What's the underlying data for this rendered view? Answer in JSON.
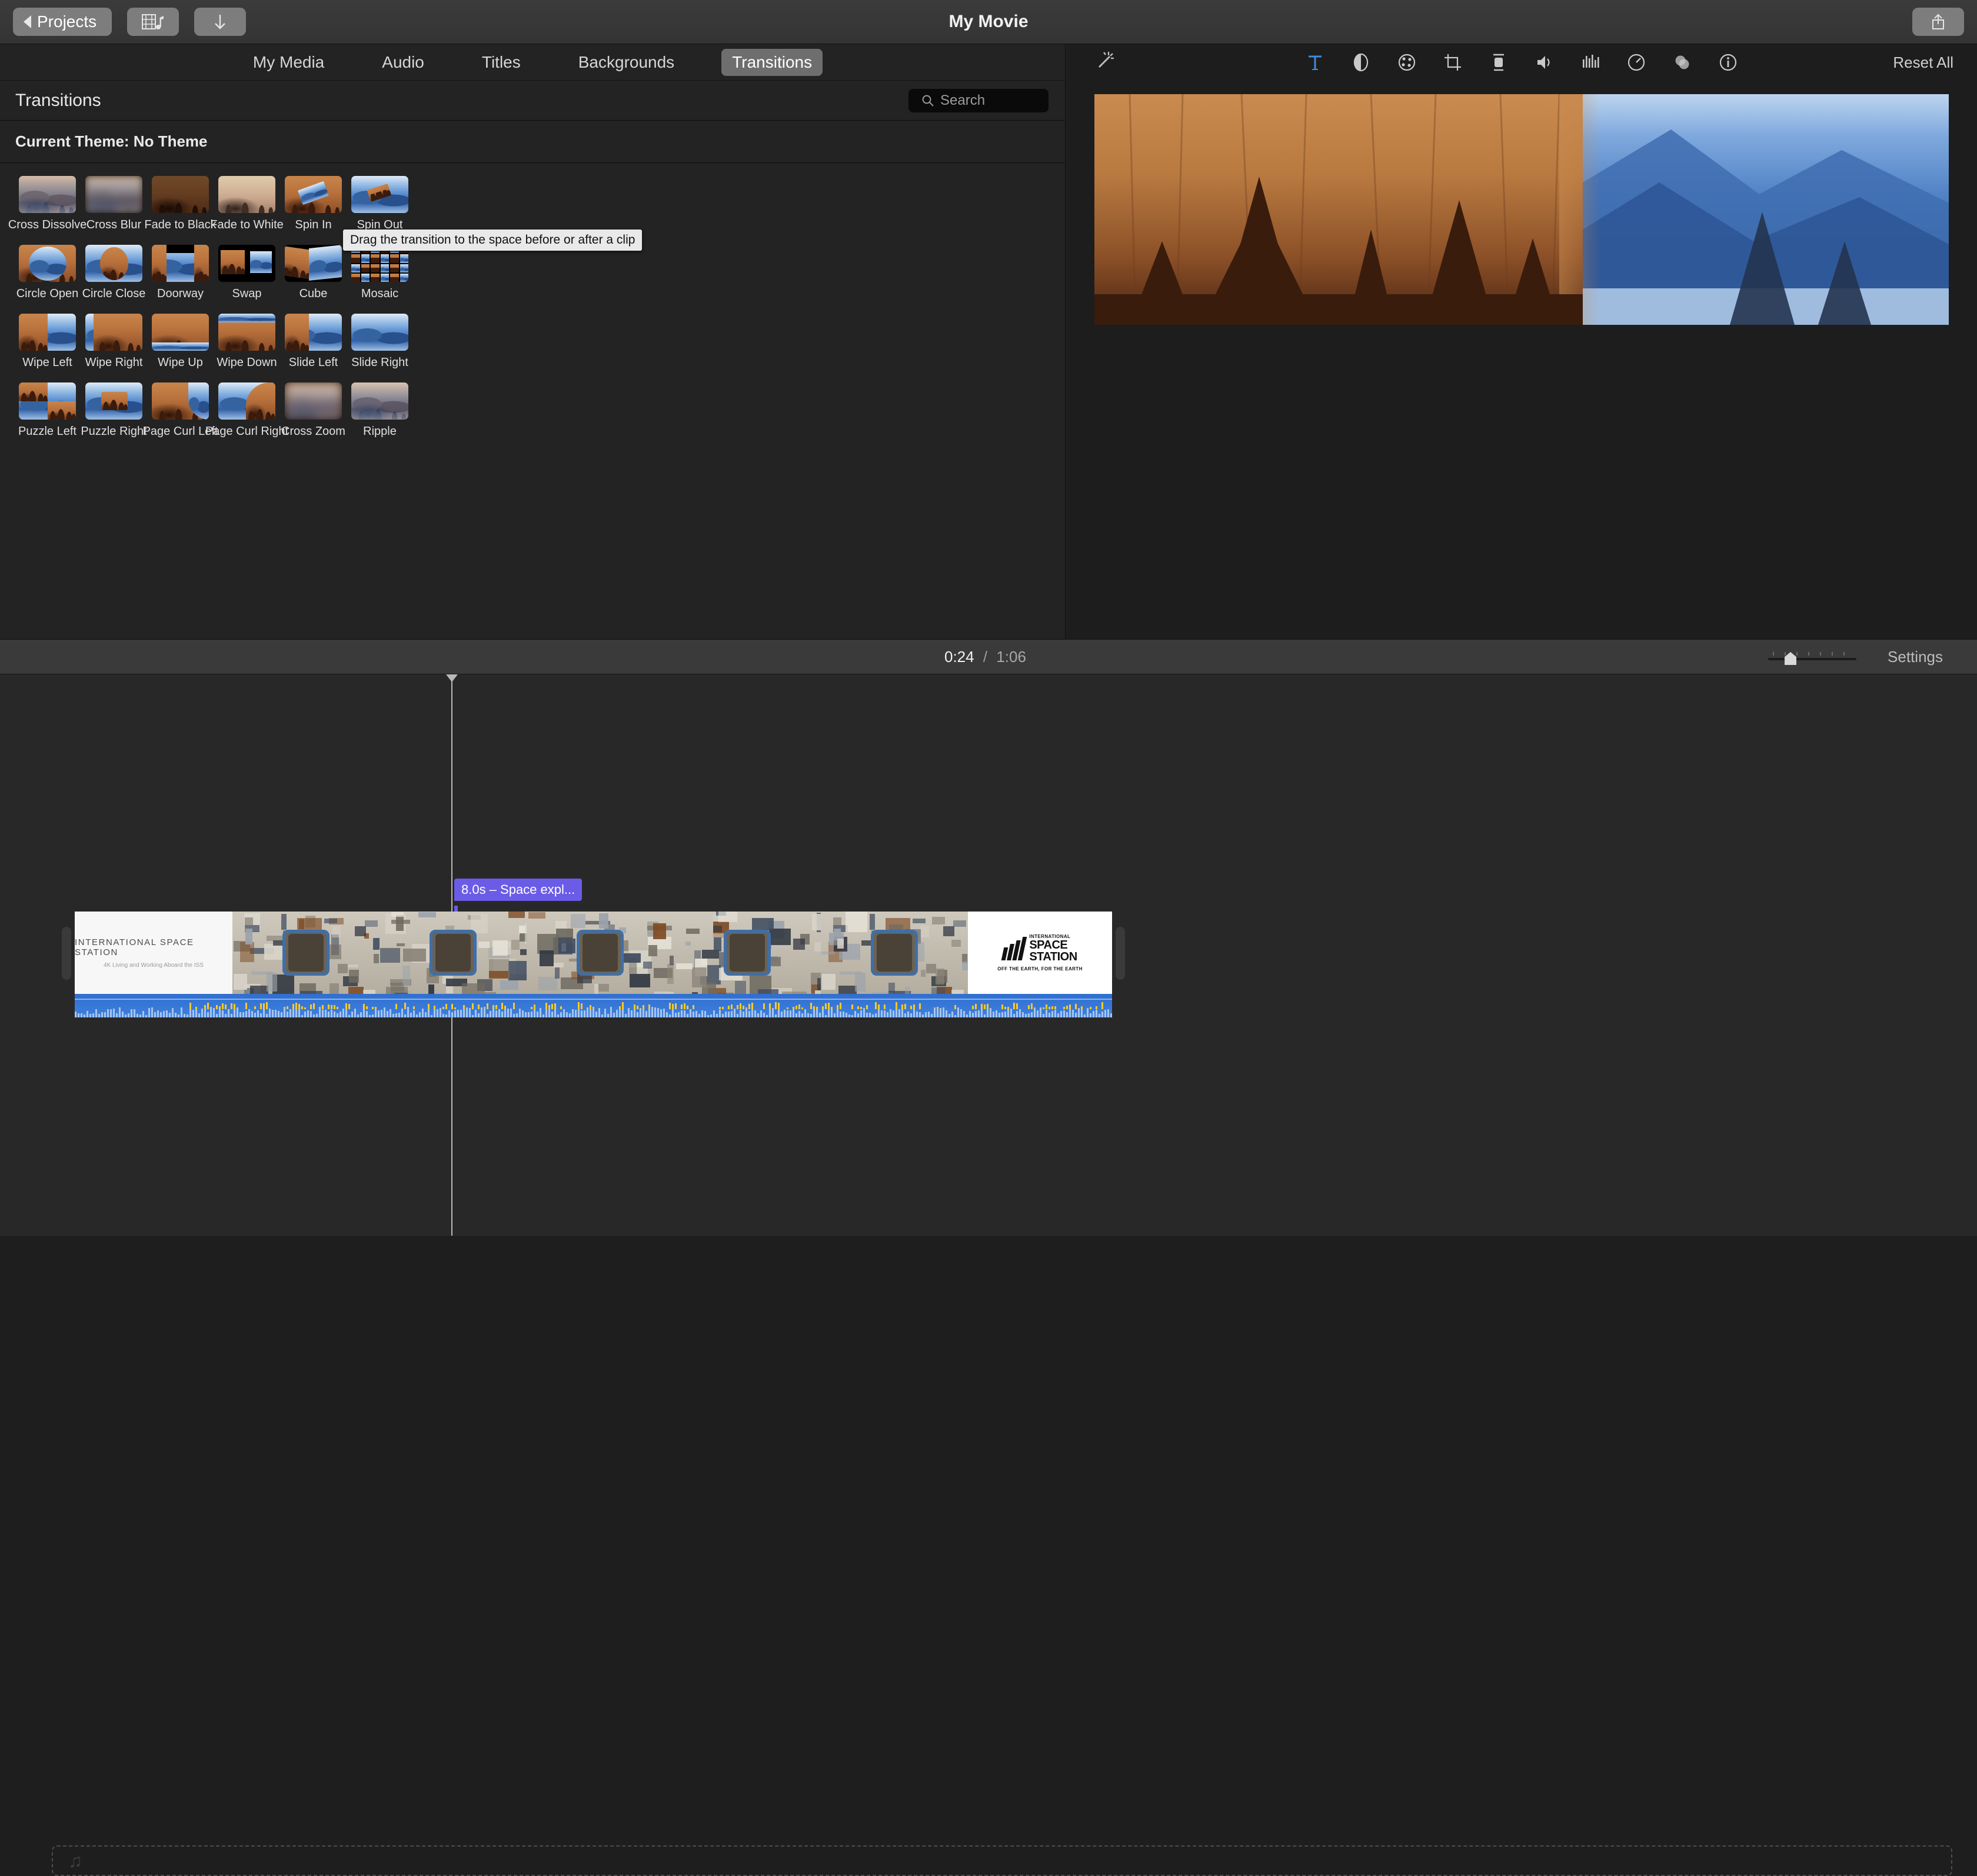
{
  "titlebar": {
    "projects_label": "Projects",
    "app_title": "My Movie",
    "media_icon": "film-music-icon",
    "download_icon": "download-icon",
    "share_icon": "share-icon"
  },
  "browser": {
    "tabs": [
      {
        "label": "My Media",
        "active": false
      },
      {
        "label": "Audio",
        "active": false
      },
      {
        "label": "Titles",
        "active": false
      },
      {
        "label": "Backgrounds",
        "active": false
      },
      {
        "label": "Transitions",
        "active": true
      }
    ],
    "panel_title": "Transitions",
    "search": {
      "placeholder": "Search",
      "value": "",
      "icon": "search-icon"
    },
    "theme_label": "Current Theme: No Theme",
    "tooltip": "Drag the transition to the space before or after a clip",
    "transitions": [
      {
        "name": "Cross Dissolve",
        "style": "cross-dissolve"
      },
      {
        "name": "Cross Blur",
        "style": "cross-blur"
      },
      {
        "name": "Fade to Black",
        "style": "fade-black"
      },
      {
        "name": "Fade to White",
        "style": "fade-white"
      },
      {
        "name": "Spin In",
        "style": "spin-in"
      },
      {
        "name": "Spin Out",
        "style": "spin-out"
      },
      {
        "name": "Circle Open",
        "style": "circle-open"
      },
      {
        "name": "Circle Close",
        "style": "circle-close"
      },
      {
        "name": "Doorway",
        "style": "doorway"
      },
      {
        "name": "Swap",
        "style": "swap"
      },
      {
        "name": "Cube",
        "style": "cube"
      },
      {
        "name": "Mosaic",
        "style": "mosaic"
      },
      {
        "name": "Wipe Left",
        "style": "wipe-left"
      },
      {
        "name": "Wipe Right",
        "style": "wipe-right"
      },
      {
        "name": "Wipe Up",
        "style": "wipe-up"
      },
      {
        "name": "Wipe Down",
        "style": "wipe-down"
      },
      {
        "name": "Slide Left",
        "style": "slide-left"
      },
      {
        "name": "Slide Right",
        "style": "slide-right"
      },
      {
        "name": "Puzzle Left",
        "style": "puzzle-left"
      },
      {
        "name": "Puzzle Right",
        "style": "puzzle-right"
      },
      {
        "name": "Page Curl Left",
        "style": "page-curl-left"
      },
      {
        "name": "Page Curl Right",
        "style": "page-curl-right"
      },
      {
        "name": "Cross Zoom",
        "style": "cross-zoom"
      },
      {
        "name": "Ripple",
        "style": "ripple"
      }
    ]
  },
  "viewer": {
    "enhance_icon": "magic-wand-icon",
    "reset_all_label": "Reset All",
    "accent_color": "#3d8ce0",
    "tools": [
      {
        "icon": "titles-icon",
        "glyph": "T",
        "active": true
      },
      {
        "icon": "color-balance-icon",
        "glyph": "",
        "active": false
      },
      {
        "icon": "color-correction-icon",
        "glyph": "",
        "active": false
      },
      {
        "icon": "crop-icon",
        "glyph": "",
        "active": false
      },
      {
        "icon": "stabilization-icon",
        "glyph": "",
        "active": false
      },
      {
        "icon": "volume-icon",
        "glyph": "",
        "active": false
      },
      {
        "icon": "noise-reduction-icon",
        "glyph": "",
        "active": false
      },
      {
        "icon": "speed-icon",
        "glyph": "",
        "active": false
      },
      {
        "icon": "clip-filter-icon",
        "glyph": "",
        "active": false
      },
      {
        "icon": "info-icon",
        "glyph": "",
        "active": false
      }
    ]
  },
  "timeline_toolbar": {
    "current_time": "0:24",
    "separator": "/",
    "total_time": "1:06",
    "settings_label": "Settings",
    "zoom_level_percent": 30
  },
  "timeline": {
    "clip_badge": "8.0s – Space expl...",
    "title_card": {
      "heading": "INTERNATIONAL SPACE STATION",
      "subheading": "4K Living and Working Aboard the ISS"
    },
    "end_card": {
      "line1": "INTERNATIONAL",
      "line2": "SPACE",
      "line3": "STATION",
      "tagline": "OFF THE EARTH, FOR THE EARTH"
    },
    "music_dropzone_icon": "music-note-icon"
  }
}
